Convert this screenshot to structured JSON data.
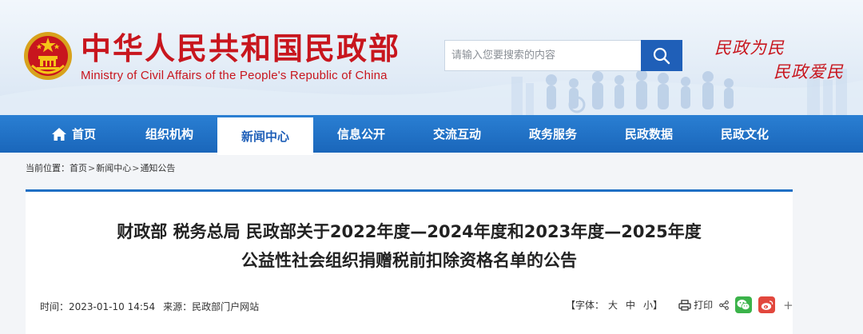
{
  "header": {
    "site_title": "中华人民共和国民政部",
    "site_subtitle": "Ministry of Civil Affairs of the People's Republic of China",
    "search_placeholder": "请输入您要搜索的内容",
    "slogan_line1": "民政为民",
    "slogan_line2": "民政爱民"
  },
  "nav": {
    "items": [
      {
        "label": "首页",
        "icon": "home-icon"
      },
      {
        "label": "组织机构"
      },
      {
        "label": "新闻中心",
        "active": true
      },
      {
        "label": "信息公开"
      },
      {
        "label": "交流互动"
      },
      {
        "label": "政务服务"
      },
      {
        "label": "民政数据"
      },
      {
        "label": "民政文化"
      }
    ]
  },
  "breadcrumb": {
    "prefix": "当前位置：",
    "items": [
      "首页",
      "新闻中心",
      "通知公告"
    ],
    "separator": ">"
  },
  "article": {
    "title_line1": "财政部 税务总局 民政部关于2022年度—2024年度和2023年度—2025年度",
    "title_line2": "公益性社会组织捐赠税前扣除资格名单的公告",
    "time_label": "时间：",
    "time_value": "2023-01-10 14:54",
    "source_label": "来源：",
    "source_value": "民政部门户网站",
    "font_label_open": "【字体：",
    "font_sizes": [
      "大",
      "中",
      "小"
    ],
    "font_label_close": "】",
    "print_label": "打印"
  },
  "colors": {
    "brand_red": "#c8161e",
    "nav_blue": "#1f70c4",
    "search_blue": "#1f5fb8"
  }
}
